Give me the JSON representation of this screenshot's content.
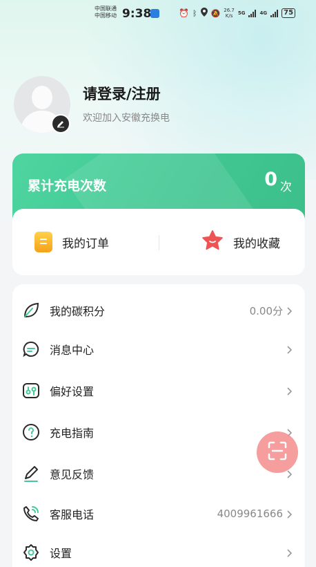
{
  "status_bar": {
    "carrier_1": "中国联通",
    "carrier_2": "中国移动",
    "time": "9:38",
    "speed_value": "26.7",
    "speed_unit": "K/s",
    "net_1": "5G",
    "net_2": "4G",
    "battery": "75"
  },
  "profile": {
    "login_title": "请登录/注册",
    "subtitle": "欢迎加入安徽充换电"
  },
  "charge_card": {
    "label": "累计充电次数",
    "count": "0",
    "unit": "次"
  },
  "quick_actions": [
    {
      "label": "我的订单",
      "icon": "orders-icon"
    },
    {
      "label": "我的收藏",
      "icon": "star-icon"
    }
  ],
  "menu": [
    {
      "label": "我的碳积分",
      "value": "0.00分",
      "icon": "leaf-icon"
    },
    {
      "label": "消息中心",
      "value": "",
      "icon": "message-icon"
    },
    {
      "label": "偏好设置",
      "value": "",
      "icon": "preferences-icon"
    },
    {
      "label": "充电指南",
      "value": "",
      "icon": "help-icon"
    },
    {
      "label": "意见反馈",
      "value": "",
      "icon": "pen-icon"
    },
    {
      "label": "客服电话",
      "value": "4009961666",
      "icon": "phone-icon"
    },
    {
      "label": "设置",
      "value": "",
      "icon": "settings-icon"
    }
  ],
  "colors": {
    "accent_green": "#43c995",
    "star_red": "#ee5454",
    "orders_orange": "#f6a11a",
    "fab_pink": "#f48c8c"
  }
}
